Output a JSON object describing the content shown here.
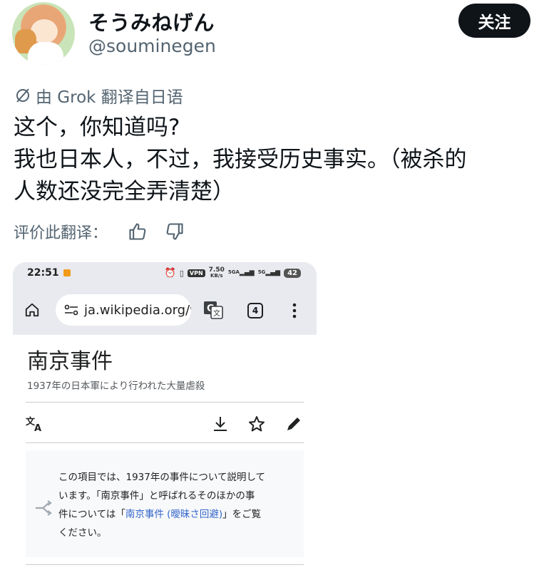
{
  "user": {
    "display_name": "そうみねげん",
    "handle": "@souminegen",
    "follow_label": "关注"
  },
  "translation": {
    "label": "由 Grok 翻译自日语",
    "rate_label": "评价此翻译："
  },
  "post": {
    "lines": [
      "这个，你知道吗?",
      "我也日本人，不过，我接受历史事实。（被杀的",
      "人数还没完全弄清楚）"
    ]
  },
  "screenshot": {
    "status": {
      "time": "22:51",
      "speed": "7.50",
      "speed_unit": "KB/s",
      "network": "5GA",
      "network2": "5G",
      "vpn": "VPN",
      "battery": "42"
    },
    "browser": {
      "url": "ja.wikipedia.org/w",
      "tab_count": "4"
    },
    "article": {
      "title": "南京事件",
      "subtitle": "1937年の日本軍により行われた大量虐殺",
      "hatnote_line1": "この項目では、1937年の事件について説明して",
      "hatnote_line2": "います。「南京事件」と呼ばれるそのほかの事",
      "hatnote_line3_pre": "件については「",
      "hatnote_link": "南京事件 (曖昧さ回避)",
      "hatnote_line3_post": "」をご覧",
      "hatnote_line4": "ください。"
    }
  },
  "colors": {
    "text": "#0f1419",
    "muted": "#536471",
    "link": "#3366cc",
    "follow_bg": "#0f1419"
  }
}
